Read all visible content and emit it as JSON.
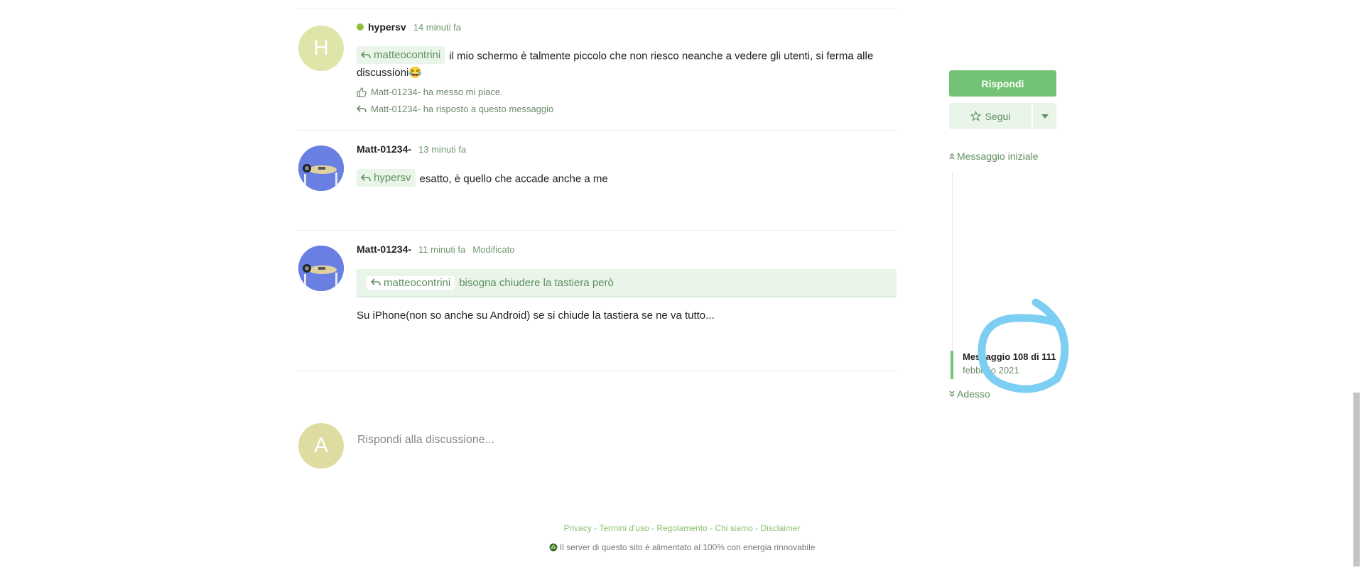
{
  "posts": [
    {
      "author": "hypersv",
      "time": "14 minuti fa",
      "avatar_letter": "H",
      "mention": "matteocontrini",
      "text_line1": "il mio schermo è talmente piccolo che non riesco neanche a vedere gli utenti, si ferma alle",
      "text_line2": "discussioni😂",
      "activity_like": "Matt-01234- ha messo mi piace.",
      "activity_reply": "Matt-01234- ha risposto a questo messaggio"
    },
    {
      "author": "Matt-01234-",
      "time": "13 minuti fa",
      "mention": "hypersv",
      "text": "esatto, è quello che accade anche a me"
    },
    {
      "author": "Matt-01234-",
      "time": "11 minuti fa",
      "edited": "Modificato",
      "quote_mention": "matteocontrini",
      "quote_text": "bisogna chiudere la tastiera però",
      "text": "Su iPhone(non so anche su Android) se si chiude la tastiera se ne va tutto..."
    }
  ],
  "composer": {
    "avatar_letter": "A",
    "placeholder": "Rispondi alla discussione..."
  },
  "sidebar": {
    "reply_button": "Rispondi",
    "follow_button": "Segui",
    "first_post": "Messaggio iniziale",
    "position": "Messaggio 108 di 111",
    "date": "febbraio 2021",
    "now": "Adesso",
    "position_fraction": 0.973
  },
  "footer": {
    "links": [
      "Privacy",
      "Termini d'uso",
      "Regolamento",
      "Chi siamo",
      "Disclaimer"
    ],
    "note": "Il server di questo sito è alimentato al 100% con energia rinnovabile"
  },
  "colors": {
    "accent": "#74c374",
    "accent_light": "#e9f5e9",
    "annotation": "#7ccff2"
  },
  "icons": [
    "reply-icon",
    "thumbs-up-icon",
    "star-icon",
    "chevron-down-icon",
    "double-chevron-up-icon",
    "double-chevron-down-icon",
    "recycle-icon"
  ]
}
